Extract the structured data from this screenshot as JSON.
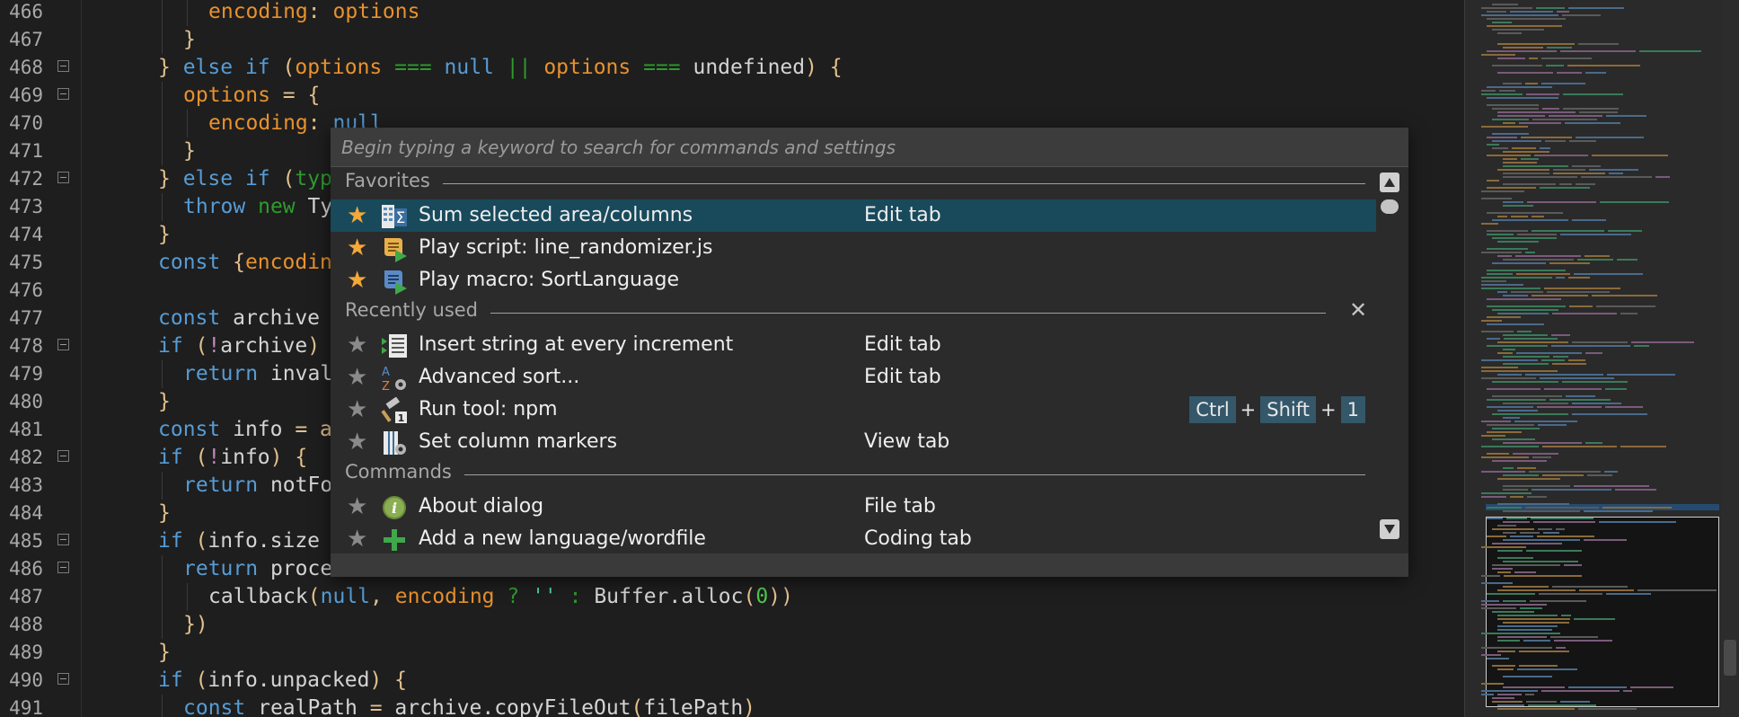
{
  "editor": {
    "lines": [
      {
        "n": "466",
        "fold": false,
        "indent": 2,
        "tokens": [
          [
            "encoding",
            "o"
          ],
          [
            ": ",
            "p"
          ],
          [
            "options",
            "o"
          ]
        ]
      },
      {
        "n": "467",
        "fold": false,
        "indent": 1,
        "tokens": [
          [
            "}",
            "p"
          ]
        ]
      },
      {
        "n": "468",
        "fold": true,
        "indent": 0,
        "tokens": [
          [
            "} ",
            "p"
          ],
          [
            "else if ",
            "k"
          ],
          [
            "(",
            "p"
          ],
          [
            "options ",
            "o"
          ],
          [
            "=== ",
            "n"
          ],
          [
            "null ",
            "k"
          ],
          [
            "|| ",
            "n"
          ],
          [
            "options ",
            "o"
          ],
          [
            "=== ",
            "n"
          ],
          [
            "undefined",
            "w"
          ],
          [
            ") {",
            "p"
          ]
        ]
      },
      {
        "n": "469",
        "fold": true,
        "indent": 1,
        "tokens": [
          [
            "options ",
            "o"
          ],
          [
            "= {",
            "p"
          ]
        ]
      },
      {
        "n": "470",
        "fold": false,
        "indent": 2,
        "tokens": [
          [
            "encoding",
            "o"
          ],
          [
            ": ",
            "p"
          ],
          [
            "null",
            "k"
          ]
        ]
      },
      {
        "n": "471",
        "fold": false,
        "indent": 1,
        "tokens": [
          [
            "}",
            "p"
          ]
        ]
      },
      {
        "n": "472",
        "fold": true,
        "indent": 0,
        "tokens": [
          [
            "} ",
            "p"
          ],
          [
            "else if ",
            "k"
          ],
          [
            "(",
            "p"
          ],
          [
            "typ",
            "n"
          ]
        ]
      },
      {
        "n": "473",
        "fold": false,
        "indent": 1,
        "tokens": [
          [
            "throw ",
            "k"
          ],
          [
            "new ",
            "n"
          ],
          [
            "Ty",
            "w"
          ]
        ]
      },
      {
        "n": "474",
        "fold": false,
        "indent": 0,
        "tokens": [
          [
            "}",
            "p"
          ]
        ]
      },
      {
        "n": "475",
        "fold": false,
        "indent": 0,
        "tokens": [
          [
            "const ",
            "k"
          ],
          [
            "{",
            "p"
          ],
          [
            "encodin",
            "o"
          ]
        ]
      },
      {
        "n": "476",
        "fold": false,
        "indent": 0,
        "tokens": []
      },
      {
        "n": "477",
        "fold": false,
        "indent": 0,
        "tokens": [
          [
            "const ",
            "k"
          ],
          [
            "archive",
            "w"
          ]
        ]
      },
      {
        "n": "478",
        "fold": true,
        "indent": 0,
        "tokens": [
          [
            "if ",
            "k"
          ],
          [
            "(",
            "p"
          ],
          [
            "!",
            "r"
          ],
          [
            "archive",
            "w"
          ],
          [
            ")",
            "p"
          ]
        ]
      },
      {
        "n": "479",
        "fold": false,
        "indent": 1,
        "tokens": [
          [
            "return ",
            "k"
          ],
          [
            "inval",
            "w"
          ]
        ]
      },
      {
        "n": "480",
        "fold": false,
        "indent": 0,
        "tokens": [
          [
            "}",
            "p"
          ]
        ]
      },
      {
        "n": "481",
        "fold": false,
        "indent": 0,
        "tokens": [
          [
            "const ",
            "k"
          ],
          [
            "info ",
            "w"
          ],
          [
            "= a",
            "p"
          ]
        ]
      },
      {
        "n": "482",
        "fold": true,
        "indent": 0,
        "tokens": [
          [
            "if ",
            "k"
          ],
          [
            "(",
            "p"
          ],
          [
            "!",
            "r"
          ],
          [
            "info",
            "w"
          ],
          [
            ") {",
            "p"
          ]
        ]
      },
      {
        "n": "483",
        "fold": false,
        "indent": 1,
        "tokens": [
          [
            "return ",
            "k"
          ],
          [
            "notFo",
            "w"
          ]
        ]
      },
      {
        "n": "484",
        "fold": false,
        "indent": 0,
        "tokens": [
          [
            "}",
            "p"
          ]
        ]
      },
      {
        "n": "485",
        "fold": true,
        "indent": 0,
        "tokens": [
          [
            "if ",
            "k"
          ],
          [
            "(",
            "p"
          ],
          [
            "info.size",
            "w"
          ]
        ]
      },
      {
        "n": "486",
        "fold": true,
        "indent": 1,
        "tokens": [
          [
            "return ",
            "k"
          ],
          [
            "proce",
            "w"
          ]
        ]
      },
      {
        "n": "487",
        "fold": false,
        "indent": 2,
        "tokens": [
          [
            "callback",
            "w"
          ],
          [
            "(",
            "p"
          ],
          [
            "null",
            "k"
          ],
          [
            ", ",
            "p"
          ],
          [
            "encoding ",
            "o"
          ],
          [
            "? ",
            "n"
          ],
          [
            "'' ",
            "m"
          ],
          [
            ": ",
            "n"
          ],
          [
            "Buffer",
            "w"
          ],
          [
            ".alloc",
            "w"
          ],
          [
            "(",
            "p"
          ],
          [
            "0",
            "g"
          ],
          [
            "))",
            "p"
          ]
        ]
      },
      {
        "n": "488",
        "fold": false,
        "indent": 1,
        "tokens": [
          [
            "})",
            "p"
          ]
        ]
      },
      {
        "n": "489",
        "fold": false,
        "indent": 0,
        "tokens": [
          [
            "}",
            "p"
          ]
        ]
      },
      {
        "n": "490",
        "fold": true,
        "indent": 0,
        "tokens": [
          [
            "if ",
            "k"
          ],
          [
            "(",
            "p"
          ],
          [
            "info.unpacked",
            "w"
          ],
          [
            ") {",
            "p"
          ]
        ]
      },
      {
        "n": "491",
        "fold": false,
        "indent": 1,
        "tokens": [
          [
            "const ",
            "k"
          ],
          [
            "realPath ",
            "w"
          ],
          [
            "= ",
            "p"
          ],
          [
            "archive",
            "w"
          ],
          [
            ".copyFileOut",
            "w"
          ],
          [
            "(",
            "p"
          ],
          [
            "filePath",
            "w"
          ],
          [
            ")",
            "p"
          ]
        ]
      }
    ]
  },
  "palette": {
    "search_placeholder": "Begin typing a keyword to search for commands and settings",
    "sections": {
      "favorites": "Favorites",
      "recent": "Recently used",
      "commands": "Commands"
    },
    "favorites": [
      {
        "label": "Sum selected area/columns",
        "tab": "Edit tab",
        "icon": "sum-columns-icon",
        "selected": true
      },
      {
        "label": "Play script: line_randomizer.js",
        "tab": "",
        "icon": "play-script-icon",
        "selected": false
      },
      {
        "label": "Play macro: SortLanguage",
        "tab": "",
        "icon": "play-macro-icon",
        "selected": false
      }
    ],
    "recent": [
      {
        "label": "Insert string at every increment",
        "tab": "Edit tab",
        "icon": "insert-string-icon"
      },
      {
        "label": "Advanced sort...",
        "tab": "Edit tab",
        "icon": "advanced-sort-icon"
      },
      {
        "label": "Run tool: npm",
        "tab": "",
        "icon": "run-tool-icon",
        "keys": [
          "Ctrl",
          "Shift",
          "1"
        ]
      },
      {
        "label": "Set column markers",
        "tab": "View tab",
        "icon": "column-markers-icon"
      }
    ],
    "commands": [
      {
        "label": "About dialog",
        "tab": "File tab",
        "icon": "info-icon"
      },
      {
        "label": "Add a new language/wordfile",
        "tab": "Coding tab",
        "icon": "add-icon"
      }
    ],
    "close_glyph": "✕",
    "plus_glyph": "+"
  },
  "colors": {
    "accent_selection": "#184a5c",
    "favorite_star": "#f4a83a",
    "inactive_star": "#8a8a8a"
  }
}
